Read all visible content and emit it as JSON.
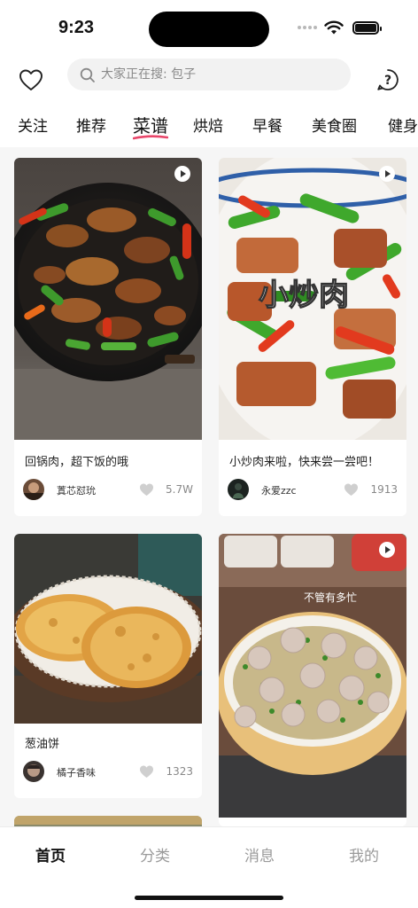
{
  "status_bar": {
    "time": "9:23"
  },
  "header": {
    "search_placeholder": "大家正在搜: 包子",
    "left_icon": "heart-outline-icon",
    "right_icon": "help-circle-icon"
  },
  "tabs": [
    {
      "label": "关注",
      "active": false
    },
    {
      "label": "推荐",
      "active": false
    },
    {
      "label": "菜谱",
      "active": true
    },
    {
      "label": "烘焙",
      "active": false
    },
    {
      "label": "早餐",
      "active": false
    },
    {
      "label": "美食圈",
      "active": false
    },
    {
      "label": "健身",
      "active": false
    }
  ],
  "feed": [
    {
      "title": "回锅肉，超下饭的哦",
      "author": "蒖芯怼玧",
      "likes": "5.7W",
      "has_video": true
    },
    {
      "title": "小炒肉来啦，快来尝一尝吧！",
      "author": "永爱zzc",
      "likes": "1913",
      "has_video": true,
      "overlay_text": "小炒肉"
    },
    {
      "title": "葱油饼",
      "author": "橘子香味",
      "likes": "1323",
      "has_video": false
    },
    {
      "title": "",
      "author": "",
      "likes": "",
      "has_video": true,
      "overlay_text": "不管有多忙"
    }
  ],
  "bottom_nav": [
    {
      "label": "首页",
      "active": true
    },
    {
      "label": "分类",
      "active": false
    },
    {
      "label": "消息",
      "active": false
    },
    {
      "label": "我的",
      "active": false
    }
  ],
  "colors": {
    "accent_underline": "#e8466a",
    "background": "#f6f6f6",
    "inactive_text": "#9a9a9a"
  }
}
